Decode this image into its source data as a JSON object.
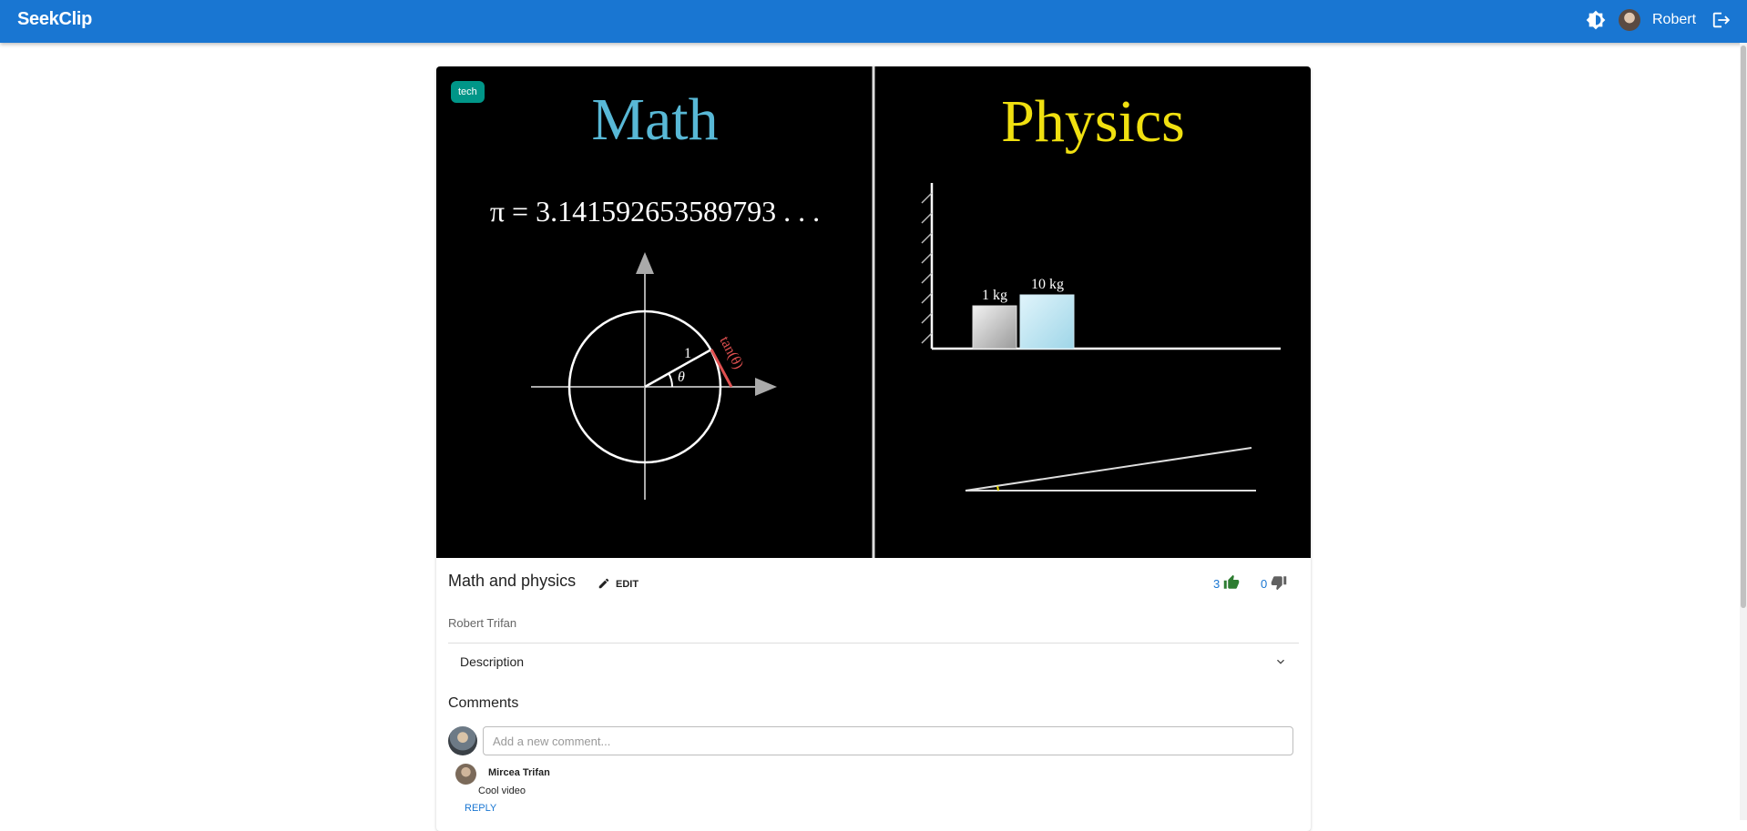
{
  "app": {
    "logo": "SeekClip",
    "user_name": "Robert"
  },
  "icons": {
    "theme": "brightness-icon",
    "logout": "logout-icon",
    "edit": "pencil-icon",
    "like": "thumb-up-icon",
    "dislike": "thumb-down-icon",
    "expand": "chevron-down-icon"
  },
  "colors": {
    "appbar": "#1976d2",
    "tag": "#009688",
    "like": "#2e7d32",
    "dislike": "#616161",
    "math_title": "#58b8d6",
    "physics_title": "#f0e010",
    "tan_label": "#e05050"
  },
  "video": {
    "tag": "tech",
    "math": {
      "title": "Math",
      "pi_text": "π = 3.141592653589793 . . .",
      "radius_label": "1",
      "angle_label": "θ",
      "tan_label": "tan(θ)"
    },
    "physics": {
      "title": "Physics",
      "mass_small": "1 kg",
      "mass_large": "10 kg"
    }
  },
  "clip": {
    "title": "Math and physics",
    "edit_label": "EDIT",
    "likes": "3",
    "dislikes": "0",
    "author": "Robert Trifan"
  },
  "description": {
    "label": "Description"
  },
  "comments": {
    "heading": "Comments",
    "input_placeholder": "Add a new comment...",
    "items": [
      {
        "author": "Mircea Trifan",
        "text": "Cool video",
        "reply_label": "REPLY"
      }
    ]
  }
}
